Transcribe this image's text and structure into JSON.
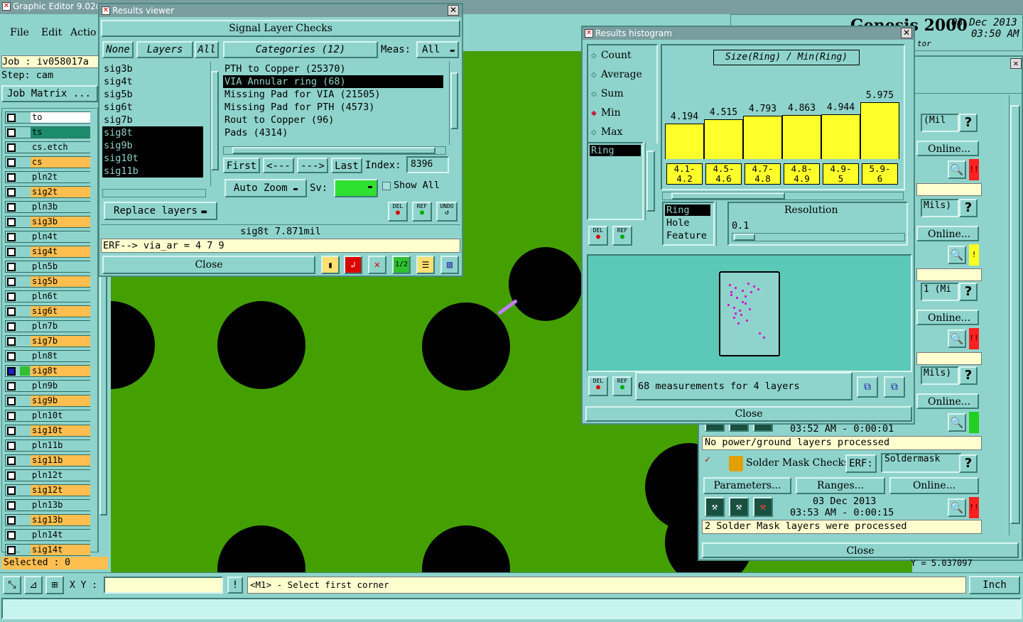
{
  "main": {
    "title": "Graphic Editor 9.02c",
    "menu": [
      "File",
      "Edit",
      "Actio"
    ],
    "brand": "Genesis 2000",
    "brand_sub": "tor",
    "date": "03 Dec 2013",
    "time": "03:50 AM",
    "job_label": "Job  :",
    "job_value": "iv058017a",
    "step_label": "Step:",
    "step_value": "cam",
    "job_matrix": "Job Matrix ...",
    "selected": "Selected : 0",
    "xy_label": "X Y :",
    "prompt": "<M1> - Select first corner",
    "units": "Inch",
    "coord_readout": "Y = 5.037097",
    "colors": {
      "board": "#44a000",
      "teal": "#8fd4cc",
      "signal": "#ffbf50",
      "via": "#c080ff"
    }
  },
  "layers": [
    {
      "name": "to",
      "color": "#ffffff"
    },
    {
      "name": "ts",
      "color": "#1c8c6c"
    },
    {
      "name": "cs.etch",
      "color": "#8fd4cc"
    },
    {
      "name": "cs",
      "color": "#ffbf50"
    },
    {
      "name": "pln2t",
      "color": "#8fd4cc"
    },
    {
      "name": "sig2t",
      "color": "#ffbf50"
    },
    {
      "name": "pln3b",
      "color": "#8fd4cc"
    },
    {
      "name": "sig3b",
      "color": "#ffbf50"
    },
    {
      "name": "pln4t",
      "color": "#8fd4cc"
    },
    {
      "name": "sig4t",
      "color": "#ffbf50"
    },
    {
      "name": "pln5b",
      "color": "#8fd4cc"
    },
    {
      "name": "sig5b",
      "color": "#ffbf50"
    },
    {
      "name": "pln6t",
      "color": "#8fd4cc"
    },
    {
      "name": "sig6t",
      "color": "#ffbf50"
    },
    {
      "name": "pln7b",
      "color": "#8fd4cc"
    },
    {
      "name": "sig7b",
      "color": "#ffbf50"
    },
    {
      "name": "pln8t",
      "color": "#8fd4cc"
    },
    {
      "name": "sig8t",
      "color": "#ffbf50"
    },
    {
      "name": "pln9b",
      "color": "#8fd4cc"
    },
    {
      "name": "sig9b",
      "color": "#ffbf50"
    },
    {
      "name": "pln10t",
      "color": "#8fd4cc"
    },
    {
      "name": "sig10t",
      "color": "#ffbf50"
    },
    {
      "name": "pln11b",
      "color": "#8fd4cc"
    },
    {
      "name": "sig11b",
      "color": "#ffbf50"
    },
    {
      "name": "pln12t",
      "color": "#8fd4cc"
    },
    {
      "name": "sig12t",
      "color": "#ffbf50"
    },
    {
      "name": "pln13b",
      "color": "#8fd4cc"
    },
    {
      "name": "sig13b",
      "color": "#ffbf50"
    },
    {
      "name": "pln14t",
      "color": "#8fd4cc"
    },
    {
      "name": "sig14t",
      "color": "#ffbf50"
    }
  ],
  "results_viewer": {
    "title": "Results viewer",
    "header": "Signal Layer Checks",
    "none_btn": "None",
    "layers_btn": "Layers",
    "all_btn": "All",
    "layer_list": [
      "sig3b",
      "sig4t",
      "sig5b",
      "sig6t",
      "sig7b",
      "sig8t",
      "sig9b",
      "sig10t",
      "sig11b"
    ],
    "categories_btn": "Categories (12)",
    "meas_label": "Meas:",
    "meas_value": "All",
    "categories": [
      "PTH to Copper (25370)",
      "VIA Annular ring (68)",
      "Missing Pad for VIA (21505)",
      "Missing Pad for PTH (4573)",
      "Rout to Copper (96)",
      "Pads (4314)"
    ],
    "first_btn": "First",
    "prev_btn": "<---",
    "next_btn": "--->",
    "last_btn": "Last",
    "index_label": "Index:",
    "index_value": "8396",
    "auto_zoom": "Auto Zoom",
    "sv_label": "Sv:",
    "show_all": "Show All",
    "replace_layers": "Replace layers",
    "del": "DEL",
    "ref": "REF",
    "undo": "UNDO",
    "status": "sig8t 7.871mil",
    "erf": "ERF--> via_ar = 4 7 9",
    "close": "Close"
  },
  "histogram": {
    "title": "Results histogram",
    "modes": [
      "Count",
      "Average",
      "Sum",
      "Min",
      "Max"
    ],
    "selected_mode": "Min",
    "list": [
      "Ring"
    ],
    "del": "DEL",
    "ref": "REF",
    "chart_title": "Size(Ring) / Min(Ring)",
    "features": [
      "Ring",
      "Hole",
      "Feature"
    ],
    "resolution_label": "Resolution",
    "resolution_value": "0.1",
    "summary": "68 measurements for 4 layers",
    "close": "Close"
  },
  "chart_data": {
    "type": "bar",
    "title": "Size(Ring) / Min(Ring)",
    "categories": [
      "4.1-\n4.2",
      "4.5-\n4.6",
      "4.7-\n4.8",
      "4.8-\n4.9",
      "4.9-\n5",
      "5.9-\n6"
    ],
    "values": [
      4.194,
      4.515,
      4.793,
      4.863,
      4.944,
      5.975
    ],
    "ylim": [
      0,
      8
    ]
  },
  "checklist": {
    "rows": [
      {
        "units": "(Mil",
        "online": "Online...",
        "status_color": "#ff2020",
        "status_text": "!!"
      },
      {
        "units": "Mils)",
        "online": "Online...",
        "status_color": "#ffff20",
        "status_text": "!"
      },
      {
        "units": "1 (Mi",
        "online": "Online...",
        "status_color": "#ff2020",
        "status_text": "!!"
      },
      {
        "units": "Mils)",
        "online": "Online...",
        "status_color": "#20d020",
        "status_text": ""
      }
    ],
    "row4_time": "03:52 AM - 0:00:01",
    "row4_status": "No power/ground layers processed",
    "solder_title": "Solder Mask Checks",
    "erf_label": "ERF:",
    "erf_value": "Soldermask",
    "help": "?",
    "parameters": "Parameters...",
    "ranges": "Ranges...",
    "online": "Online...",
    "solder_date": "03 Dec 2013",
    "solder_time": "03:53 AM - 0:00:15",
    "solder_status": "2 Solder Mask layers were processed",
    "close": "Close"
  }
}
